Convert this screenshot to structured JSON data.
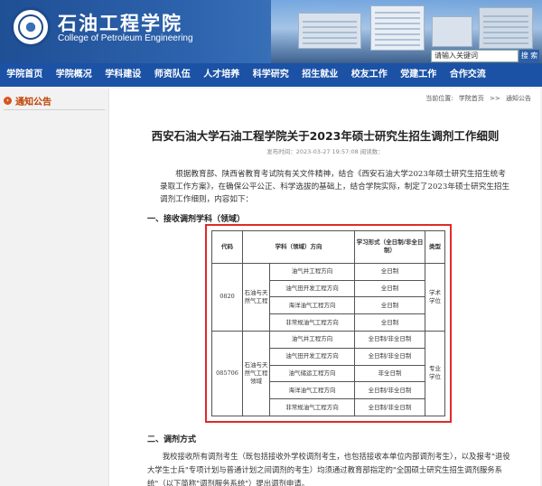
{
  "header": {
    "site_name": "石油工程学院",
    "site_name_en": "College of Petroleum Engineering",
    "search_placeholder": "请输入关键词",
    "search_button": "搜 索"
  },
  "nav": {
    "items": [
      "学院首页",
      "学院概况",
      "学科建设",
      "师资队伍",
      "人才培养",
      "科学研究",
      "招生就业",
      "校友工作",
      "党建工作",
      "合作交流"
    ]
  },
  "sidebar": {
    "title": "通知公告",
    "title_icon": "bullet-icon"
  },
  "breadcrumb": {
    "items": [
      "当前位置:",
      "学院首页",
      ">>",
      "通知公告"
    ]
  },
  "article": {
    "title": "西安石油大学石油工程学院关于2023年硕士研究生招生调剂工作细则",
    "meta": "发布时间：2023-03-27 19:57:08  阅读数：",
    "intro": "根据教育部、陕西省教育考试院有关文件精神，结合《西安石油大学2023年硕士研究生招生统考录取工作方案》，在确保公平公正、科学选拔的基础上，结合学院实际，制定了2023年硕士研究生招生调剂工作细则，内容如下：",
    "section1": "一、接收调剂学科（领域）",
    "section2": "二、调剂方式",
    "body2": "我校接收所有调剂考生（既包括接收外学校调剂考生，也包括接收本单位内部调剂考生），以及报考\"退役大学生士兵\"专项计划与普通计划之间调剂的考生）均须通过教育部指定的\"全国硕士研究生招生调剂服务系统\"（以下简称\"调剂服务系统\"）提出调剂申请。"
  },
  "table": {
    "headers": {
      "code": "代码",
      "discipline": "学科（领域）方向",
      "form": "学习形式（全日制/非全日制）",
      "type": "类型"
    },
    "group1": {
      "code": "0820",
      "name": "石油与天然气工程",
      "type": "学术学位",
      "rows": [
        {
          "dir": "油气井工程方向",
          "form": "全日制"
        },
        {
          "dir": "油气田开发工程方向",
          "form": "全日制"
        },
        {
          "dir": "海洋油气工程方向",
          "form": "全日制"
        },
        {
          "dir": "非常规油气工程方向",
          "form": "全日制"
        }
      ]
    },
    "group2": {
      "code": "085706",
      "name": "石油与天然气工程领域",
      "type": "专业学位",
      "rows": [
        {
          "dir": "油气井工程方向",
          "form": "全日制/非全日制"
        },
        {
          "dir": "油气田开发工程方向",
          "form": "全日制/非全日制"
        },
        {
          "dir": "油气储运工程方向",
          "form": "非全日制"
        },
        {
          "dir": "海洋油气工程方向",
          "form": "全日制/非全日制"
        },
        {
          "dir": "非常规油气工程方向",
          "form": "全日制/非全日制"
        }
      ]
    }
  },
  "colors": {
    "nav_bg": "#1b52a6",
    "table_highlight": "#e02a2a",
    "sidebar_accent": "#c04000"
  }
}
